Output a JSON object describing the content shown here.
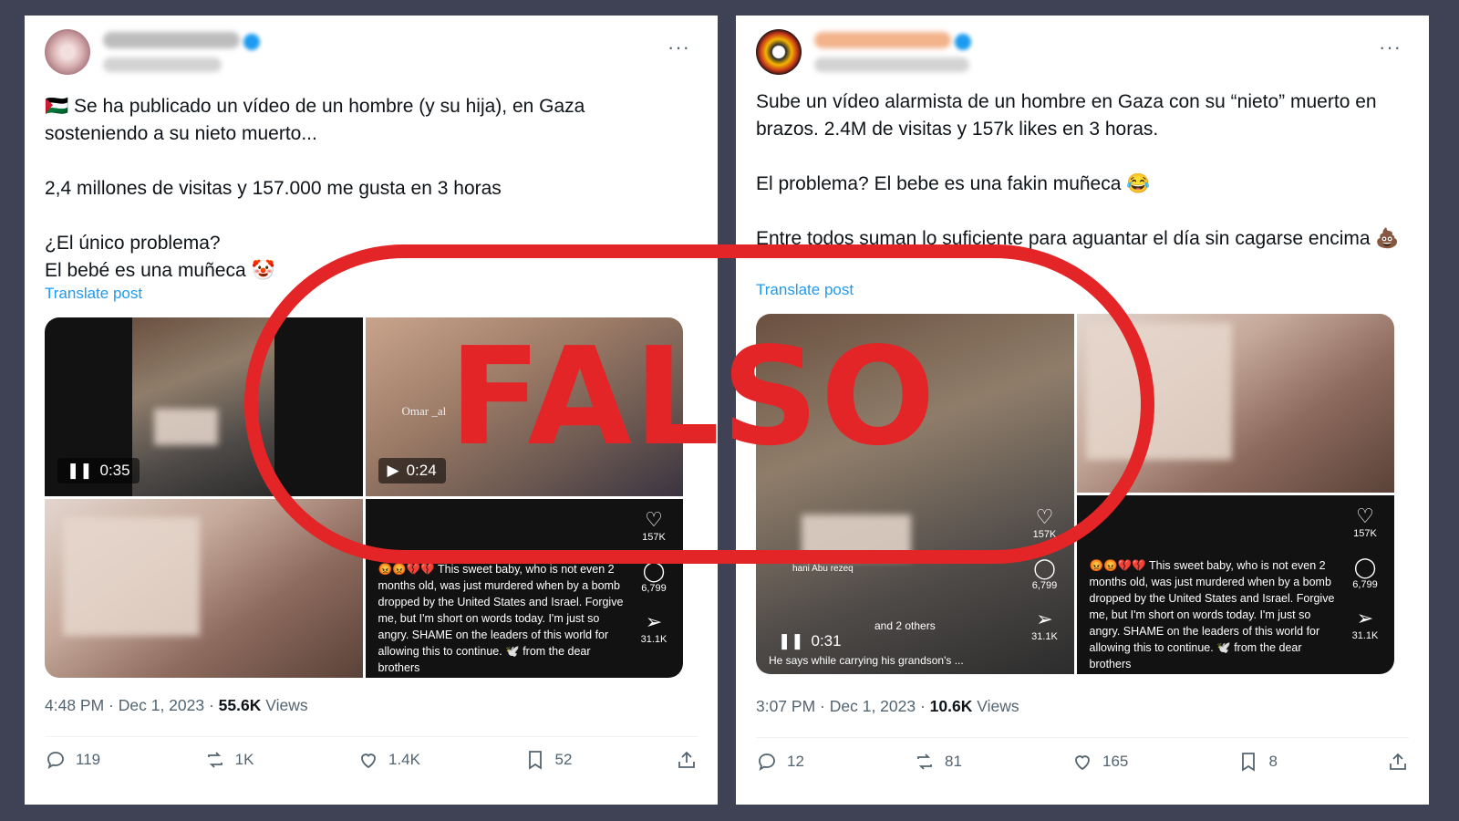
{
  "posts": [
    {
      "more_label": "···",
      "text": "🇵🇸 Se ha publicado un vídeo de un hombre (y su hija), en Gaza sosteniendo a su nieto muerto...\n\n2,4 millones de visitas y 157.000 me gusta en 3 horas\n\n¿El único problema?\nEl bebé es una muñeca 🤡",
      "translate_label": "Translate post",
      "media": {
        "tile1_duration": "0:35",
        "tile1_icon": "pause-icon",
        "tile2_duration": "0:24",
        "tile2_icon": "play-icon",
        "tile2_watermark": "Omar _al",
        "tile4_likes": "157K",
        "tile4_comments": "6,799",
        "tile4_shares": "31.1K",
        "tile4_overlay": "😡😡💔💔 This sweet baby, who is not even 2 months old, was just murdered when by a bomb dropped by the United States and Israel. Forgive me, but I'm short on words today. I'm just so angry. SHAME on the leaders of this world for allowing this to continue. 🕊️ from the dear brothers"
      },
      "timestamp": "4:48 PM · Dec 1, 2023 · ",
      "views_count": "55.6K",
      "views_label": " Views",
      "replies": "119",
      "reposts": "1K",
      "likes": "1.4K",
      "bookmarks": "52"
    },
    {
      "more_label": "···",
      "text": "Sube un vídeo alarmista de un hombre en Gaza con su “nieto” muerto en brazos. 2.4M de visitas y 157k likes en 3 horas.\n\nEl problema? El bebe es una fakin muñeca 😂\n\nEntre todos suman lo suficiente para aguantar el día sin cagarse encima 💩",
      "translate_label": "Translate post",
      "media": {
        "tile1_duration": "0:31",
        "tile1_icon": "pause-icon",
        "tile1_likes": "157K",
        "tile1_comments": "6,799",
        "tile1_shares": "31.1K",
        "tile1_user": "hani Abu rezeq",
        "tile1_meta": "and 2 others",
        "tile1_caption": "He says while carrying his grandson's ...",
        "tile4_likes": "157K",
        "tile4_comments": "6,799",
        "tile4_shares": "31.1K",
        "tile4_overlay": "😡😡💔💔 This sweet baby, who is not even 2 months old, was just murdered when by a bomb dropped by the United States and Israel. Forgive me, but I'm short on words today. I'm just so angry. SHAME on the leaders of this world for allowing this to continue. 🕊️ from the dear brothers"
      },
      "timestamp": "3:07 PM · Dec 1, 2023 · ",
      "views_count": "10.6K",
      "views_label": " Views",
      "replies": "12",
      "reposts": "81",
      "likes": "165",
      "bookmarks": "8"
    }
  ],
  "stamp": {
    "text": "FALSO",
    "color": "#e42527"
  },
  "colors": {
    "background": "#3f4154",
    "link": "#1d9bf0",
    "muted": "#536471"
  }
}
